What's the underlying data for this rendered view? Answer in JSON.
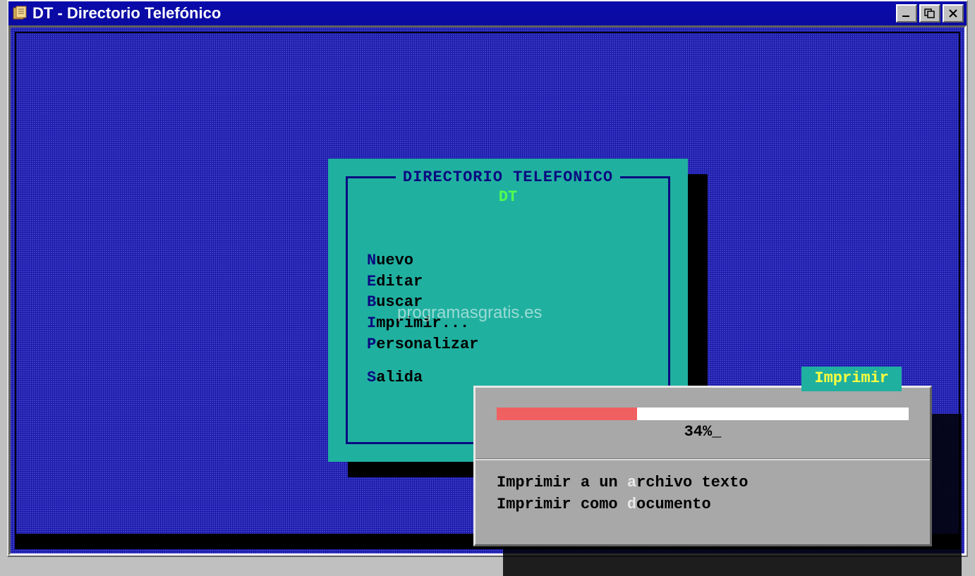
{
  "window": {
    "title": "DT - Directorio Telefónico"
  },
  "menu": {
    "title": "DIRECTORIO TELEFONICO",
    "subtitle": "DT",
    "items": [
      {
        "hotkey": "N",
        "rest": "uevo"
      },
      {
        "hotkey": "E",
        "rest": "ditar"
      },
      {
        "hotkey": "B",
        "rest": "uscar"
      },
      {
        "hotkey": "I",
        "rest": "mprimir..."
      },
      {
        "hotkey": "P",
        "rest": "ersonalizar"
      }
    ],
    "exit": {
      "hotkey": "S",
      "rest": "alida"
    }
  },
  "dialog": {
    "title": "Imprimir",
    "progress_percent": 34,
    "progress_label": "34%_",
    "options": [
      {
        "pre": "Imprimir a un ",
        "hotkey": "a",
        "post": "rchivo texto"
      },
      {
        "pre": "Imprimir como ",
        "hotkey": "d",
        "post": "ocumento"
      }
    ]
  },
  "watermark": "programasgratis.es"
}
